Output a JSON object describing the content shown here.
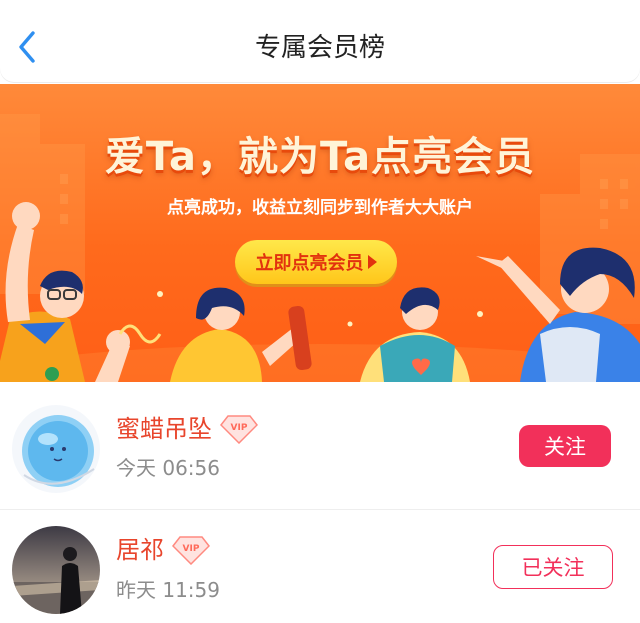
{
  "header": {
    "title": "专属会员榜",
    "back_icon": "chevron-left-icon",
    "accent": "#2f8ff0"
  },
  "banner": {
    "headline": "爱Ta，就为Ta点亮会员",
    "subline": "点亮成功，收益立刻同步到作者大大账户",
    "cta_label": "立即点亮会员",
    "colors": {
      "background": "#ff6a1c",
      "cta_fill": "#ffd22a",
      "cta_text": "#e2320e"
    }
  },
  "members": [
    {
      "name": "蜜蜡吊坠",
      "badge": "VIP",
      "time": "今天 06:56",
      "follow_label": "关注",
      "following": false
    },
    {
      "name": "居祁",
      "badge": "VIP",
      "time": "昨天 11:59",
      "follow_label": "已关注",
      "following": true
    }
  ],
  "colors": {
    "name": "#e8452c",
    "follow_primary": "#f2305a",
    "time": "#8c8c8c"
  }
}
